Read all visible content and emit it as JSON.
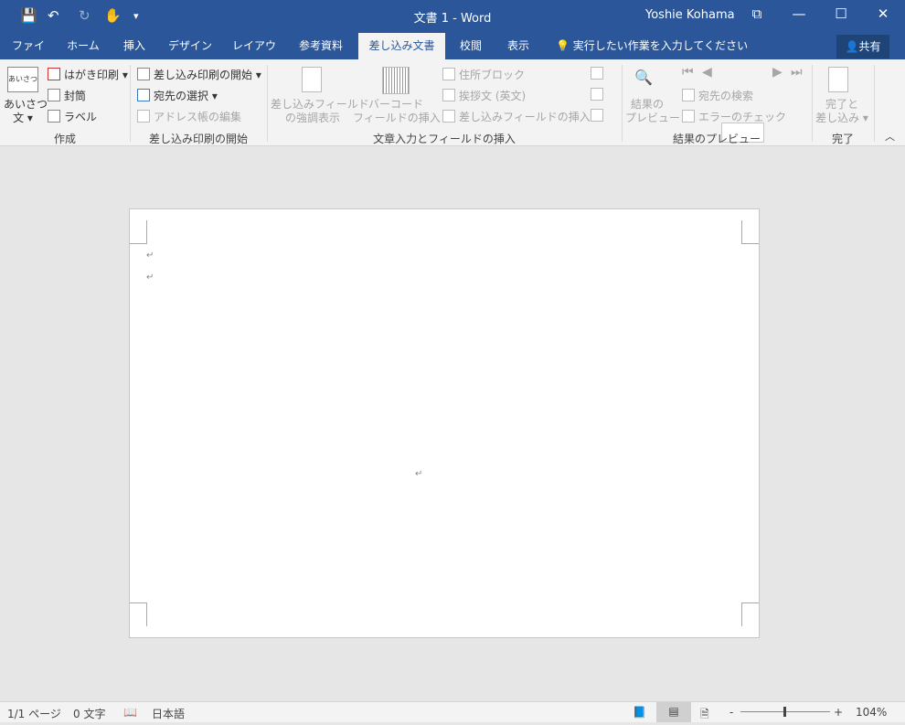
{
  "titlebar": {
    "title": "文書 1 - Word",
    "user": "Yoshie Kohama",
    "save_icon": "💾",
    "undo_icon": "↶",
    "redo_icon": "↻",
    "touch_icon": "✋",
    "customize_icon": "▾",
    "ribbon_display_icon": "⧉",
    "minimize_icon": "—",
    "maximize_icon": "☐",
    "close_icon": "✕"
  },
  "tabs": [
    "ファイル",
    "ホーム",
    "挿入",
    "デザイン",
    "レイアウト",
    "参考資料",
    "差し込み文書",
    "校閲",
    "表示"
  ],
  "tell_me": "実行したい作業を入力してください",
  "share": "共有",
  "ribbon": {
    "create": {
      "greeting_line1": "あいさつ",
      "greeting_line2": "文 ▾",
      "greeting_icon_text": "あいさつ",
      "postcard": "はがき印刷 ▾",
      "envelope": "封筒",
      "label": "ラベル",
      "group": "作成"
    },
    "start": {
      "start_merge": "差し込み印刷の開始 ▾",
      "select_recipients": "宛先の選択 ▾",
      "edit_list": "アドレス帳の編集",
      "group": "差し込み印刷の開始"
    },
    "fields": {
      "highlight1": "差し込みフィールド",
      "highlight2": "の強調表示",
      "barcode1": "バーコード",
      "barcode2": "フィールドの挿入 ▾",
      "address_block": "住所ブロック",
      "greeting_line": "挨拶文 (英文)",
      "insert_field": "差し込みフィールドの挿入 ▾",
      "group": "文章入力とフィールドの挿入"
    },
    "preview": {
      "preview1": "結果の",
      "preview2": "プレビュー",
      "find": "宛先の検索",
      "check": "エラーのチェック",
      "group": "結果のプレビュー",
      "record": ""
    },
    "finish": {
      "finish1": "完了と",
      "finish2": "差し込み ▾",
      "group": "完了"
    }
  },
  "document": {
    "paragraph_mark": "↵"
  },
  "status": {
    "page": "1/1 ページ",
    "words": "0 文字",
    "language": "日本語",
    "zoom": "104%",
    "zoom_minus": "-",
    "zoom_plus": "+"
  }
}
